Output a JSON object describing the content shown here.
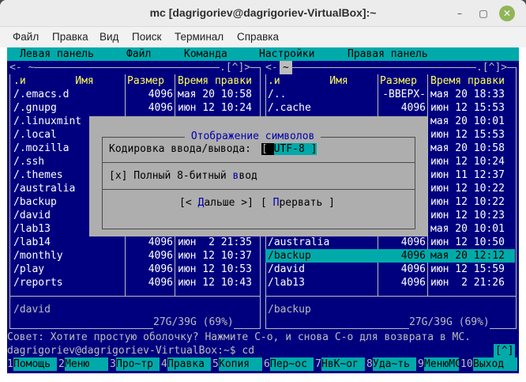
{
  "window": {
    "title": "mc [dagrigoriev@dagrigoriev-VirtualBox]:~"
  },
  "menubar": [
    "Файл",
    "Правка",
    "Вид",
    "Поиск",
    "Терминал",
    "Справка"
  ],
  "mc_menu": [
    "Левая панель",
    "Файл",
    "Команда",
    "Настройки",
    "Правая панель"
  ],
  "left_panel": {
    "top_left": "<- ~",
    "top_right": ".[^]>",
    "headers": {
      "name": ".и        Имя",
      "size": "Размер",
      "time": "Время правки"
    },
    "files": [
      {
        "name": "/.emacs.d",
        "size": "4096",
        "time": "мая 20 10:58"
      },
      {
        "name": "/.gnupg",
        "size": "4096",
        "time": "июн 12 10:24"
      },
      {
        "name": "/.linuxmint",
        "size": "",
        "time": ""
      },
      {
        "name": "/.local",
        "size": "",
        "time": ""
      },
      {
        "name": "/.mozilla",
        "size": "",
        "time": ""
      },
      {
        "name": "/.ssh",
        "size": "",
        "time": ""
      },
      {
        "name": "/.themes",
        "size": "",
        "time": ""
      },
      {
        "name": "/australia",
        "size": "",
        "time": ""
      },
      {
        "name": "/backup",
        "size": "",
        "time": ""
      },
      {
        "name": "/david",
        "size": "",
        "time": ""
      },
      {
        "name": "/lab13",
        "size": "",
        "time": ""
      },
      {
        "name": "/lab14",
        "size": "4096",
        "time": "июн  2 21:35"
      },
      {
        "name": "/monthly",
        "size": "4096",
        "time": "июн 12 10:37"
      },
      {
        "name": "/play",
        "size": "4096",
        "time": "июн 12 10:53"
      },
      {
        "name": "/reports",
        "size": "4096",
        "time": "июн 12 10:43"
      }
    ],
    "status": "/david",
    "disk": "27G/39G (69%)"
  },
  "right_panel": {
    "top_left": "<- ",
    "path": "~",
    "top_right": ".[^]>",
    "headers": {
      "name": ".и        Имя",
      "size": "Размер",
      "time": "Время правки"
    },
    "files": [
      {
        "name": "/..",
        "size": "-ВВЕРХ-",
        "time": "мая 20 18:33"
      },
      {
        "name": "/.cache",
        "size": "4096",
        "time": "июн 12 15:53"
      },
      {
        "name": "",
        "size": "",
        "time": "мая 20 10:01"
      },
      {
        "name": "",
        "size": "",
        "time": "июн 12 15:53"
      },
      {
        "name": "",
        "size": "",
        "time": "мая 20 10:58"
      },
      {
        "name": "",
        "size": "",
        "time": "июн 12 10:24"
      },
      {
        "name": "",
        "size": "",
        "time": "июн 11 12:37"
      },
      {
        "name": "",
        "size": "",
        "time": "июн 12 10:22"
      },
      {
        "name": "",
        "size": "",
        "time": "июн 12 10:22"
      },
      {
        "name": "",
        "size": "",
        "time": "июн 12 10:23"
      },
      {
        "name": "",
        "size": "",
        "time": "мая 20 10:01"
      },
      {
        "name": "/australia",
        "size": "4096",
        "time": "июн 12 10:50"
      },
      {
        "name": "/backup",
        "size": "4096",
        "time": "мая 20 12:12"
      },
      {
        "name": "/david",
        "size": "4096",
        "time": "июн 12 15:59"
      },
      {
        "name": "/lab13",
        "size": "4096",
        "time": "июн  2 21:26"
      }
    ],
    "selected_index": 12,
    "status": "/backup",
    "disk": "27G/39G (69%)"
  },
  "dialog": {
    "title": " Отображение символов ",
    "encoding_label": "Кодировка ввода/вывода:",
    "encoding_value": "UTF-8",
    "checkbox": "[x] Полный 8-битный ",
    "checkbox_hot": "в",
    "checkbox_tail": "вод",
    "btn_next_open": "[< ",
    "btn_next_hot": "Д",
    "btn_next_rest": "альше >]",
    "btn_cancel_open": "[ ",
    "btn_cancel_hot": "П",
    "btn_cancel_rest": "рервать ]"
  },
  "hint": "Совет: Хотите простую оболочку? Нажмите C-o, и снова C-o для возврата в МС.",
  "prompt": "dagrigoriev@dagrigoriev-VirtualBox:~$ cd",
  "prompt_right": "[^]",
  "fkeys": [
    {
      "n": "1",
      "l": "Помощь"
    },
    {
      "n": "2",
      "l": "Меню"
    },
    {
      "n": "3",
      "l": "Про~тр"
    },
    {
      "n": "4",
      "l": "Правка"
    },
    {
      "n": "5",
      "l": "Копия"
    },
    {
      "n": "6",
      "l": "Пер~ос"
    },
    {
      "n": "7",
      "l": "НвК~ог"
    },
    {
      "n": "8",
      "l": "Уда~ть"
    },
    {
      "n": "9",
      "l": "МенюМС"
    },
    {
      "n": "10",
      "l": "Выход"
    }
  ],
  "colors": {
    "term_bg": "#00007f",
    "accent": "#00aaaa",
    "header": "#ffff55",
    "dialog_bg": "#aeaeae"
  }
}
